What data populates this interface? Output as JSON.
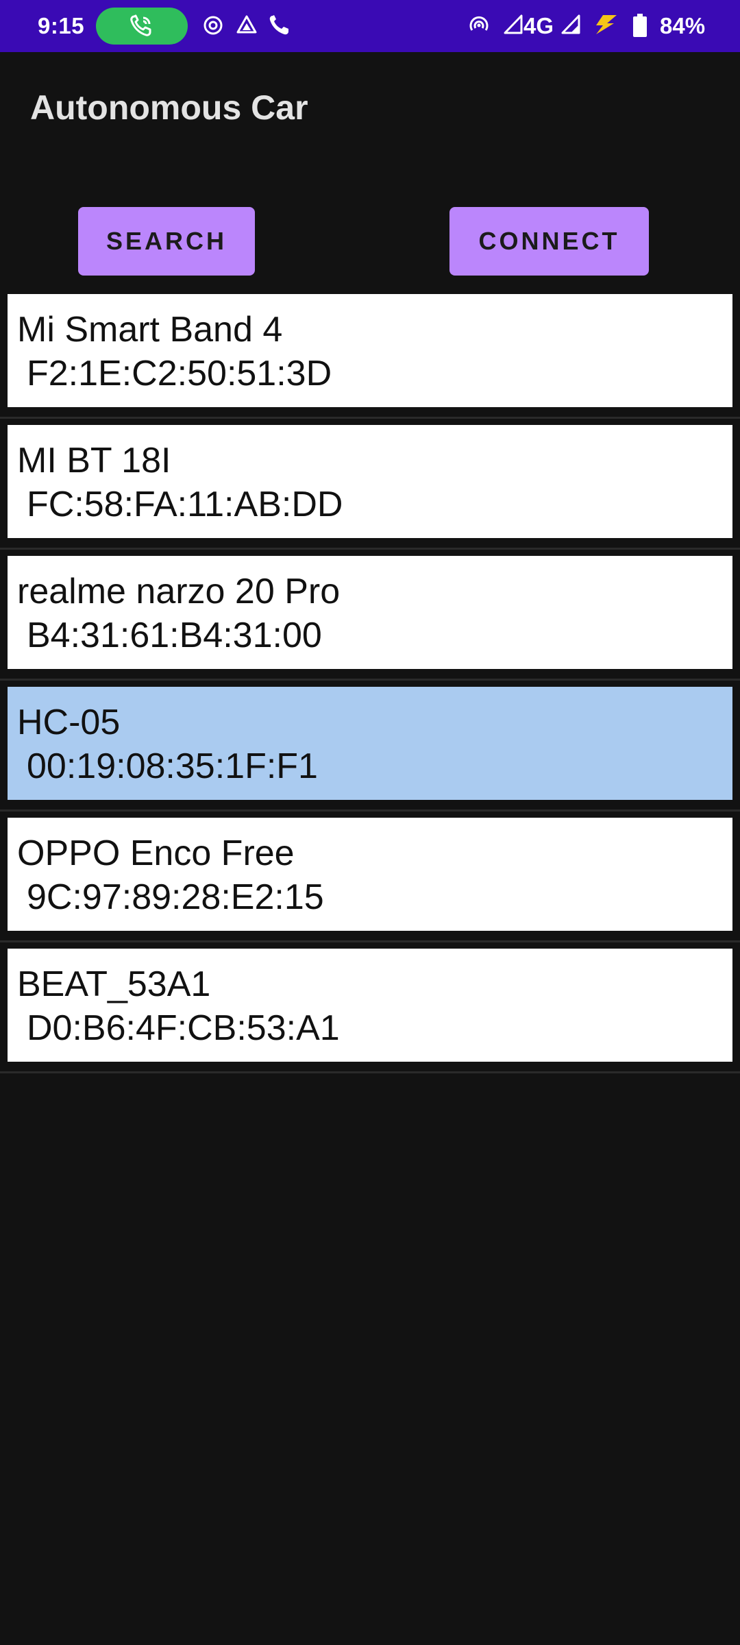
{
  "status_bar": {
    "time": "9:15",
    "network": "4G",
    "battery": "84%",
    "icons": [
      "call-active-icon",
      "hotspot-icon",
      "drive-icon",
      "phone-icon",
      "hotspot-signal-icon",
      "signal-icon",
      "signal-icon",
      "charging-icon",
      "battery-icon"
    ]
  },
  "app": {
    "title": "Autonomous Car"
  },
  "buttons": {
    "search": "SEARCH",
    "connect": "CONNECT"
  },
  "devices": [
    {
      "name": "Mi Smart Band 4",
      "mac": "F2:1E:C2:50:51:3D",
      "selected": false
    },
    {
      "name": "MI BT 18I",
      "mac": "FC:58:FA:11:AB:DD",
      "selected": false
    },
    {
      "name": "realme narzo 20 Pro",
      "mac": "B4:31:61:B4:31:00",
      "selected": false
    },
    {
      "name": "HC-05",
      "mac": "00:19:08:35:1F:F1",
      "selected": true
    },
    {
      "name": "OPPO Enco Free",
      "mac": "9C:97:89:28:E2:15",
      "selected": false
    },
    {
      "name": "BEAT_53A1",
      "mac": "D0:B6:4F:CB:53:A1",
      "selected": false
    }
  ],
  "colors": {
    "status_bar": "#3a0ab4",
    "background": "#121212",
    "accent": "#bb86fc",
    "selected_row": "#aacbf0",
    "call_pill": "#2fbd5c"
  }
}
